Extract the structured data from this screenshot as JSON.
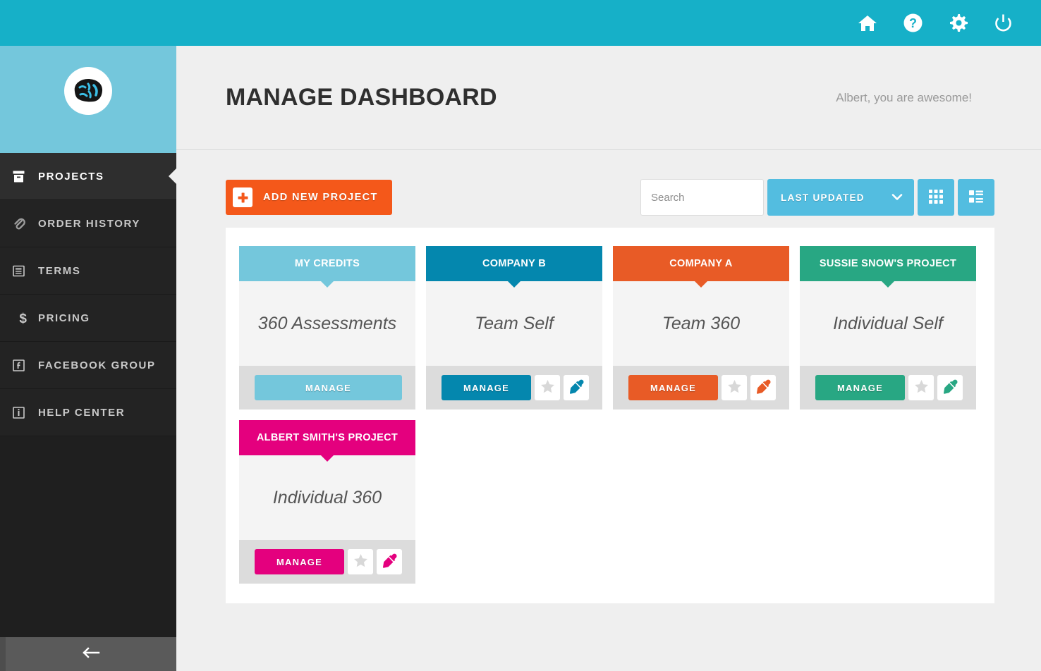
{
  "topbar": {
    "background": "#16b0c8",
    "icons": [
      {
        "name": "home-icon",
        "label": "Home"
      },
      {
        "name": "help-icon",
        "label": "Help"
      },
      {
        "name": "settings-gear-icon",
        "label": "Settings"
      },
      {
        "name": "power-logout-icon",
        "label": "Log out"
      }
    ]
  },
  "sidebar": {
    "logo": {
      "icon": "brain-logo-icon",
      "background": "#74c7dc"
    },
    "items": [
      {
        "label": "PROJECTS",
        "icon": "archive-box-icon",
        "active": true
      },
      {
        "label": "ORDER HISTORY",
        "icon": "paperclip-icon",
        "active": false
      },
      {
        "label": "TERMS",
        "icon": "document-lines-icon",
        "active": false
      },
      {
        "label": "PRICING",
        "icon": "dollar-sign-icon",
        "active": false
      },
      {
        "label": "FACEBOOK GROUP",
        "icon": "facebook-square-icon",
        "active": false
      },
      {
        "label": "HELP CENTER",
        "icon": "info-square-icon",
        "active": false
      }
    ],
    "collapse": {
      "icon": "arrow-left-icon",
      "label": "Collapse menu"
    }
  },
  "header": {
    "title": "MANAGE DASHBOARD",
    "greeting": "Albert, you are awesome!"
  },
  "toolbar": {
    "add_project_label": "ADD NEW PROJECT",
    "add_project_color": "#f4581a",
    "plus_icon": "plus-icon",
    "search": {
      "value": "",
      "placeholder": "Search",
      "icon": "search-icon"
    },
    "sort": {
      "label": "LAST UPDATED",
      "icon": "chevron-down-icon",
      "color": "#53bde0"
    },
    "grid_view": {
      "icon": "grid-view-icon",
      "active": false
    },
    "list_view": {
      "icon": "list-view-icon",
      "active": true
    }
  },
  "cards": [
    {
      "title": "MY CREDITS",
      "subtitle": "360 Assessments",
      "color": "#74c7dc",
      "manage_label": "MANAGE",
      "has_star": false,
      "has_color_picker": false,
      "star_icon": "star-icon",
      "picker_icon": "eyedropper-icon"
    },
    {
      "title": "COMPANY B",
      "subtitle": "Team Self",
      "color": "#0487ae",
      "manage_label": "MANAGE",
      "has_star": true,
      "has_color_picker": true,
      "star_icon": "star-icon",
      "picker_icon": "eyedropper-icon"
    },
    {
      "title": "COMPANY A",
      "subtitle": "Team 360",
      "color": "#e85b26",
      "manage_label": "MANAGE",
      "has_star": true,
      "has_color_picker": true,
      "star_icon": "star-icon",
      "picker_icon": "eyedropper-icon"
    },
    {
      "title": "SUSSIE SNOW'S PROJECT",
      "subtitle": "Individual Self",
      "color": "#28a783",
      "manage_label": "MANAGE",
      "has_star": true,
      "has_color_picker": true,
      "star_icon": "star-icon",
      "picker_icon": "eyedropper-icon"
    },
    {
      "title": "ALBERT SMITH'S PROJECT",
      "subtitle": "Individual 360",
      "color": "#e4007e",
      "manage_label": "MANAGE",
      "has_star": true,
      "has_color_picker": true,
      "star_icon": "star-icon",
      "picker_icon": "eyedropper-icon"
    }
  ]
}
